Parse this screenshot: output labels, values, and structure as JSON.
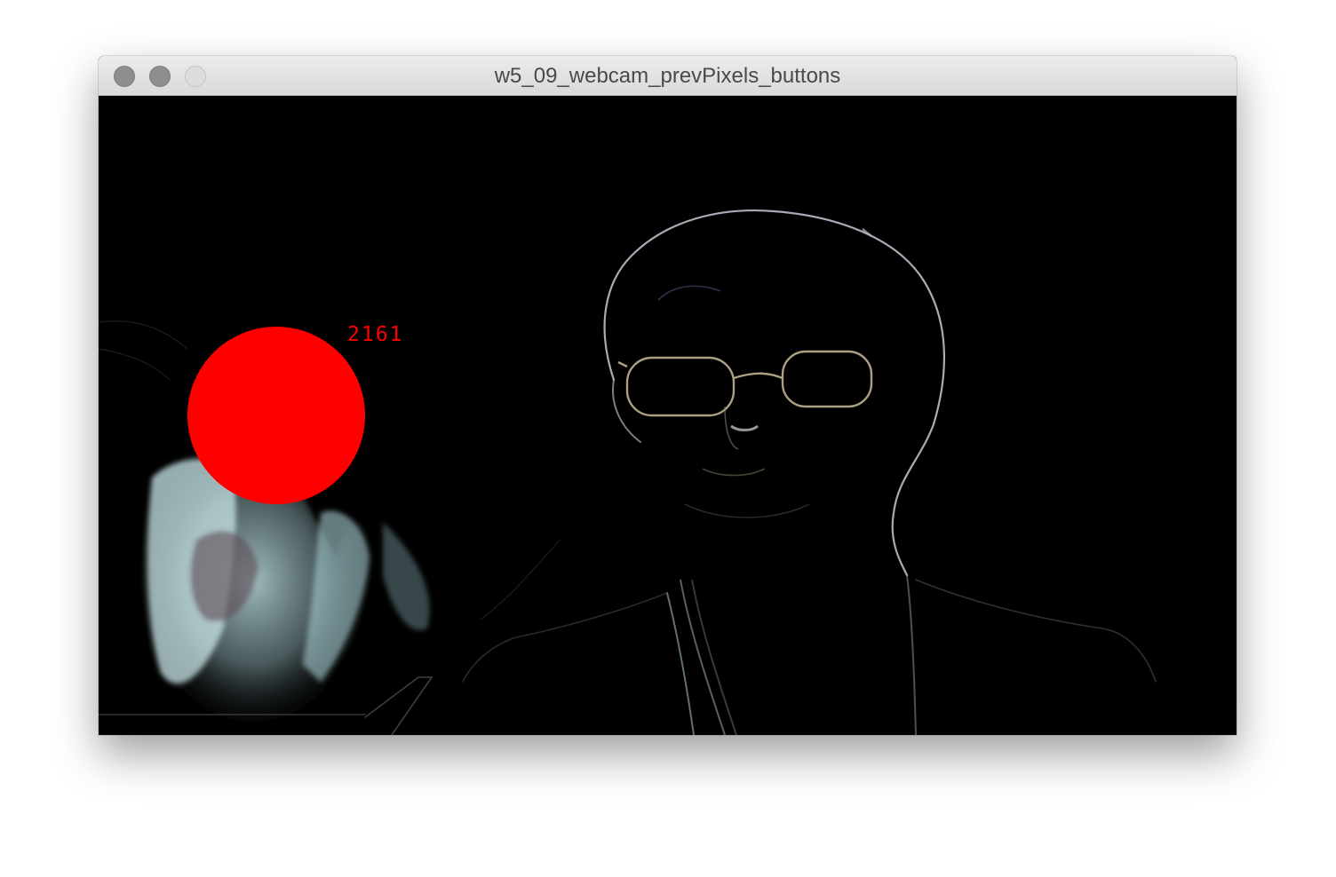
{
  "window": {
    "title": "w5_09_webcam_prevPixels_buttons"
  },
  "canvas": {
    "button_color": "#ff0000",
    "counter_value": "2161"
  },
  "icons": {
    "close": "traffic-light-close",
    "minimize": "traffic-light-minimize",
    "maximize": "traffic-light-maximize"
  }
}
